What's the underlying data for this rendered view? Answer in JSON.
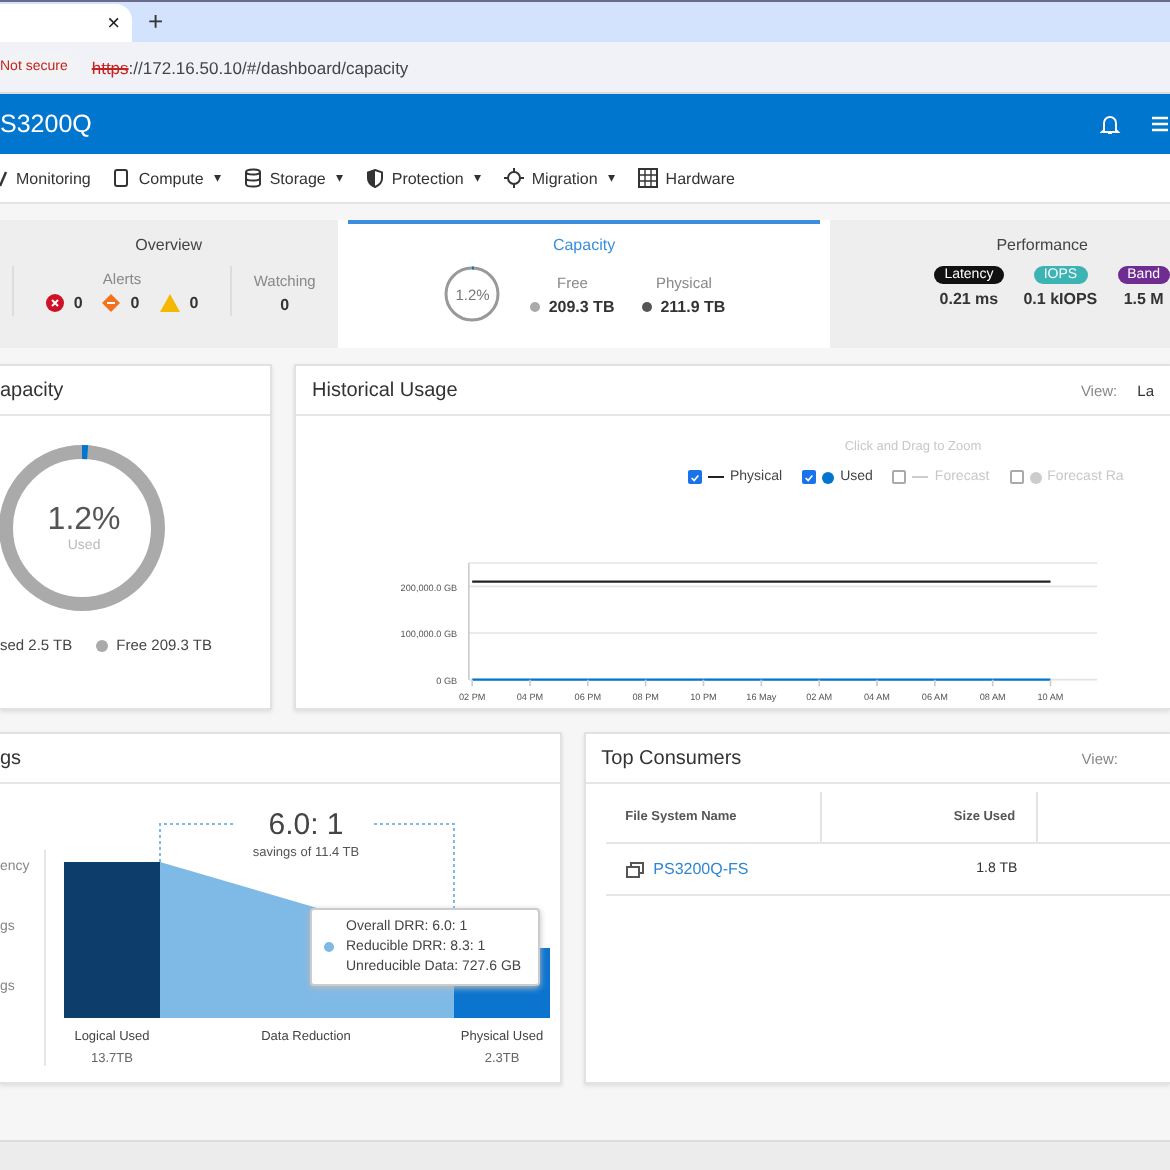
{
  "browser": {
    "tab_close": "×",
    "new_tab": "+",
    "security": "Not secure",
    "url_scheme": "https",
    "url_rest": "://172.16.50.10/#/dashboard/capacity"
  },
  "app_bar": {
    "title": "S3200Q"
  },
  "nav": [
    {
      "label": "Monitoring"
    },
    {
      "label": "Compute",
      "caret": "▾"
    },
    {
      "label": "Storage",
      "caret": "▾"
    },
    {
      "label": "Protection",
      "caret": "▾"
    },
    {
      "label": "Migration",
      "caret": "▾"
    },
    {
      "label": "Hardware"
    }
  ],
  "summary_tabs": [
    {
      "kind": "overview",
      "title": "Overview",
      "selected": false,
      "alerts_label": "Alerts",
      "alerts": [
        {
          "kind": "critical",
          "count": "0"
        },
        {
          "kind": "major",
          "count": "0"
        },
        {
          "kind": "minor",
          "count": "0"
        }
      ],
      "watching_label": "Watching",
      "watching": "0"
    },
    {
      "kind": "capacity",
      "title": "Capacity",
      "selected": true,
      "ring": "1.2%",
      "level": 0.012,
      "stats": [
        {
          "label": "Free",
          "value": "209.3 TB",
          "color": "#aaaaaa"
        },
        {
          "label": "Physical",
          "value": "211.9 TB",
          "color": "#555555"
        }
      ]
    },
    {
      "kind": "performance",
      "title": "Performance",
      "selected": false,
      "metrics": [
        {
          "label": "Latency",
          "value": "0.21 ms",
          "color": "#111111"
        },
        {
          "label": "IOPS",
          "value": "0.1 kIOPS",
          "color": "#3cb4b4"
        },
        {
          "label": "Band",
          "value": "1.5 M",
          "color": "#6f2c91"
        }
      ]
    }
  ],
  "capacity_card": {
    "title": "apacity",
    "level": 0.012,
    "percent": "1.2%",
    "caption": "Used",
    "legend": [
      {
        "label": "sed 2.5 TB"
      },
      {
        "label": "Free 209.3 TB",
        "color": "#aaaaaa"
      }
    ]
  },
  "history_card": {
    "title": "Historical Usage",
    "view_label": "View:",
    "view_value": "La",
    "hint": "Click and Drag to Zoom",
    "legend": [
      {
        "kind": "line",
        "checked": true
      },
      {
        "kind": "dot",
        "checked": true
      },
      {
        "kind": "line",
        "label": "Forecast",
        "checked": false,
        "color": "#cccccc"
      },
      {
        "kind": "dot",
        "label": "Forecast Ra",
        "checked": false,
        "color": "#cccccc"
      }
    ],
    "chart_data": {
      "type": "line",
      "categories": [
        "02 PM",
        "04 PM",
        "06 PM",
        "08 PM",
        "10 PM",
        "16 May",
        "02 AM",
        "04 AM",
        "06 AM",
        "08 AM",
        "10 AM"
      ],
      "series": [
        {
          "name": "Physical",
          "color": "#222222",
          "values": [
            210000,
            210000,
            210000,
            210000,
            210000,
            210000,
            210000,
            210000,
            210000,
            210000,
            210000
          ]
        },
        {
          "name": "Used",
          "color": "#0076ce",
          "values": [
            0,
            0,
            0,
            0,
            0,
            0,
            0,
            0,
            0,
            0,
            0
          ]
        }
      ],
      "ylim": [
        0,
        250000
      ],
      "yticks": [
        {
          "value": 0,
          "label": "0 GB"
        },
        {
          "value": 100000,
          "label": "100,000.0 GB"
        },
        {
          "value": 200000,
          "label": "200,000.0 GB"
        }
      ]
    }
  },
  "savings_card": {
    "title": "gs",
    "side_items": [
      "ency",
      "gs",
      "gs"
    ],
    "ratio": "6.0: 1",
    "savings": "savings of 11.4 TB",
    "bars": [
      {
        "label": "Logical Used",
        "value": "13.7TB"
      },
      {
        "label": "Data Reduction"
      },
      {
        "label": "Physical Used",
        "value": "2.3TB"
      }
    ],
    "tooltip": [
      "Overall DRR: 6.0: 1",
      "Reducible DRR: 8.3: 1",
      "Unreducible Data: 727.6 GB"
    ]
  },
  "consumers_card": {
    "title": "Top Consumers",
    "view_label": "View:",
    "columns": [
      "File System Name",
      "Size Used"
    ],
    "rows": [
      {
        "name": "PS3200Q-FS",
        "size": "1.8 TB"
      }
    ]
  }
}
